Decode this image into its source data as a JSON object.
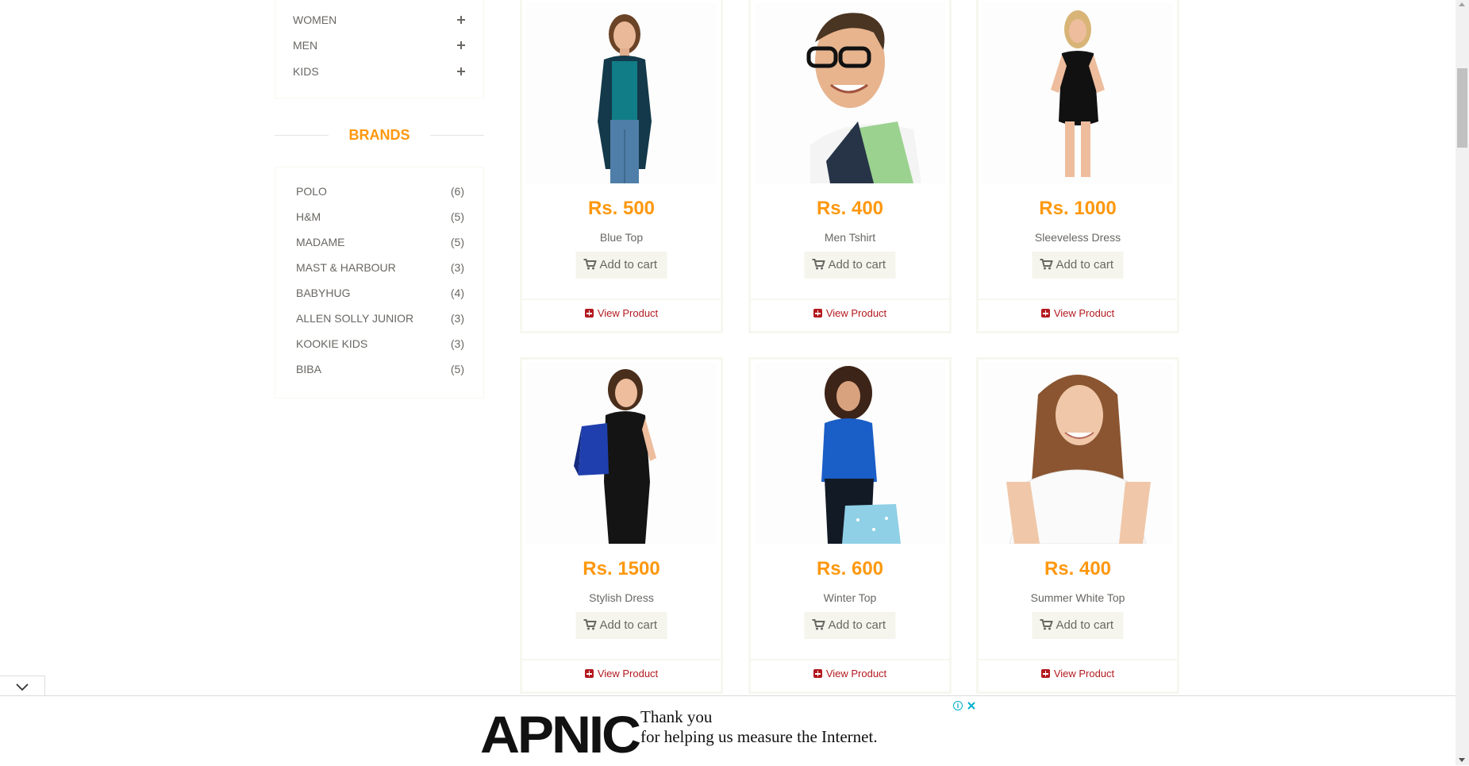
{
  "categories": [
    {
      "label": "WOMEN"
    },
    {
      "label": "MEN"
    },
    {
      "label": "KIDS"
    }
  ],
  "brands_title": "BRANDS",
  "brands": [
    {
      "name": "POLO",
      "count": "(6)"
    },
    {
      "name": "H&M",
      "count": "(5)"
    },
    {
      "name": "MADAME",
      "count": "(5)"
    },
    {
      "name": "MAST & HARBOUR",
      "count": "(3)"
    },
    {
      "name": "BABYHUG",
      "count": "(4)"
    },
    {
      "name": "ALLEN SOLLY JUNIOR",
      "count": "(3)"
    },
    {
      "name": "KOOKIE KIDS",
      "count": "(3)"
    },
    {
      "name": "BIBA",
      "count": "(5)"
    }
  ],
  "products": [
    {
      "price": "Rs. 500",
      "name": "Blue Top",
      "add_label": "Add to cart",
      "view_label": "View Product"
    },
    {
      "price": "Rs. 400",
      "name": "Men Tshirt",
      "add_label": "Add to cart",
      "view_label": "View Product"
    },
    {
      "price": "Rs. 1000",
      "name": "Sleeveless Dress",
      "add_label": "Add to cart",
      "view_label": "View Product"
    },
    {
      "price": "Rs. 1500",
      "name": "Stylish Dress",
      "add_label": "Add to cart",
      "view_label": "View Product"
    },
    {
      "price": "Rs. 600",
      "name": "Winter Top",
      "add_label": "Add to cart",
      "view_label": "View Product"
    },
    {
      "price": "Rs. 400",
      "name": "Summer White Top",
      "add_label": "Add to cart",
      "view_label": "View Product"
    }
  ],
  "ad": {
    "logo": "APNIC",
    "line1": "Thank you",
    "line2": "for helping us measure the Internet."
  },
  "colors": {
    "accent": "#FE980F",
    "view_link": "#B3191F",
    "text": "#696763"
  }
}
